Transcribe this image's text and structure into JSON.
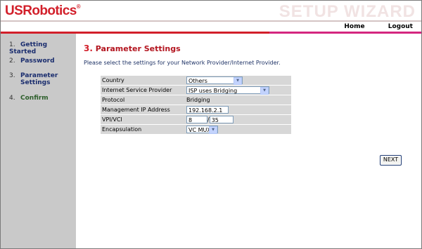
{
  "brand": {
    "logo_text": "USRobotics",
    "logo_mark": "®",
    "wizard_title": "SETUP WIZARD"
  },
  "topnav": {
    "home": "Home",
    "logout": "Logout"
  },
  "steps": [
    {
      "num": "1.",
      "label": "Getting Started"
    },
    {
      "num": "2.",
      "label": "Password"
    },
    {
      "num": "3.",
      "label": "Parameter Settings"
    },
    {
      "num": "4.",
      "label": "Confirm"
    }
  ],
  "section": {
    "num": "3.",
    "title": "Parameter Settings",
    "intro": "Please select the settings for your Network Provider/Internet Provider."
  },
  "form": {
    "country": {
      "label": "Country",
      "value": "Others"
    },
    "isp": {
      "label": "Internet Service Provider",
      "value": "ISP uses Bridging"
    },
    "protocol": {
      "label": "Protocol",
      "value": "Bridging"
    },
    "mgmt_ip": {
      "label": "Management IP Address",
      "value": "192.168.2.1"
    },
    "vpivci": {
      "label": "VPI/VCI",
      "vpi": "8",
      "separator": "/",
      "vci": "35"
    },
    "encapsulation": {
      "label": "Encapsulation",
      "value": "VC MUX"
    }
  },
  "buttons": {
    "next": "NEXT"
  },
  "colors": {
    "brand_red": "#d21f2a",
    "accent_pink": "#d4267f",
    "sidebar_gray": "#c9c9c9",
    "nav_blue": "#1a2d6e"
  }
}
